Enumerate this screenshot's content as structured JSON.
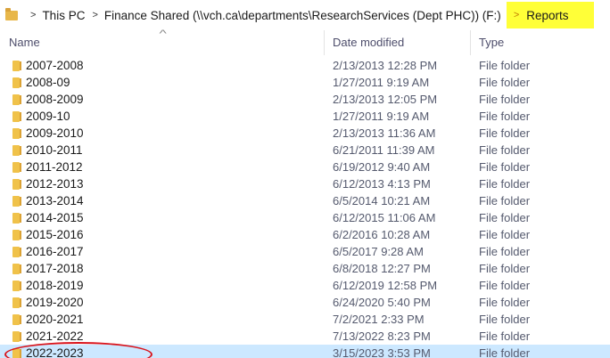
{
  "addressbar": {
    "pc_label": "This PC",
    "drive_label": "Finance Shared (\\\\vch.ca\\departments\\ResearchServices (Dept PHC)) (F:)",
    "current_folder": "Reports",
    "highlight_color": "#ffff38"
  },
  "columns": {
    "name": "Name",
    "date": "Date modified",
    "type": "Type",
    "sort_indicator": "^"
  },
  "rows": [
    {
      "name": "2007-2008",
      "date": "2/13/2013 12:28 PM",
      "type": "File folder"
    },
    {
      "name": "2008-09",
      "date": "1/27/2011 9:19 AM",
      "type": "File folder"
    },
    {
      "name": "2008-2009",
      "date": "2/13/2013 12:05 PM",
      "type": "File folder"
    },
    {
      "name": "2009-10",
      "date": "1/27/2011 9:19 AM",
      "type": "File folder"
    },
    {
      "name": "2009-2010",
      "date": "2/13/2013 11:36 AM",
      "type": "File folder"
    },
    {
      "name": "2010-2011",
      "date": "6/21/2011 11:39 AM",
      "type": "File folder"
    },
    {
      "name": "2011-2012",
      "date": "6/19/2012 9:40 AM",
      "type": "File folder"
    },
    {
      "name": "2012-2013",
      "date": "6/12/2013 4:13 PM",
      "type": "File folder"
    },
    {
      "name": "2013-2014",
      "date": "6/5/2014 10:21 AM",
      "type": "File folder"
    },
    {
      "name": "2014-2015",
      "date": "6/12/2015 11:06 AM",
      "type": "File folder"
    },
    {
      "name": "2015-2016",
      "date": "6/2/2016 10:28 AM",
      "type": "File folder"
    },
    {
      "name": "2016-2017",
      "date": "6/5/2017 9:28 AM",
      "type": "File folder"
    },
    {
      "name": "2017-2018",
      "date": "6/8/2018 12:27 PM",
      "type": "File folder"
    },
    {
      "name": "2018-2019",
      "date": "6/12/2019 12:58 PM",
      "type": "File folder"
    },
    {
      "name": "2019-2020",
      "date": "6/24/2020 5:40 PM",
      "type": "File folder"
    },
    {
      "name": "2020-2021",
      "date": "7/2/2021 2:33 PM",
      "type": "File folder"
    },
    {
      "name": "2021-2022",
      "date": "7/13/2022 8:23 PM",
      "type": "File folder"
    },
    {
      "name": "2022-2023",
      "date": "3/15/2023 3:53 PM",
      "type": "File folder",
      "selected": true
    }
  ],
  "colors": {
    "selection": "#cce8ff",
    "folder": "#f0c24a",
    "annotation_circle": "#d9141c"
  }
}
